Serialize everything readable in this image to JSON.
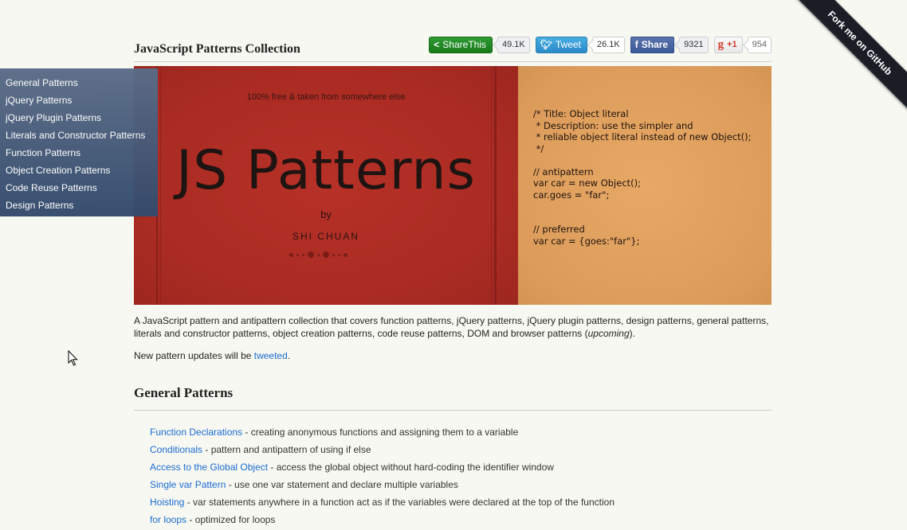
{
  "header": {
    "title": "JavaScript Patterns Collection",
    "social": {
      "sharethis": {
        "label": "ShareThis",
        "count": "49.1K",
        "icon": "share-icon"
      },
      "tweet": {
        "label": "Tweet",
        "count": "26.1K",
        "icon": "twitter-bird-icon"
      },
      "facebook": {
        "label": "Share",
        "count": "9321",
        "icon": "facebook-f-icon"
      },
      "gplus": {
        "label": "+1",
        "count": "954",
        "icon": "google-g-icon"
      }
    }
  },
  "ribbon": {
    "label": "Fork me on GitHub"
  },
  "sidebar": {
    "items": [
      {
        "label": "General Patterns"
      },
      {
        "label": "jQuery Patterns"
      },
      {
        "label": "jQuery Plugin Patterns"
      },
      {
        "label": "Literals and Constructor Patterns"
      },
      {
        "label": "Function Patterns"
      },
      {
        "label": "Object Creation Patterns"
      },
      {
        "label": "Code Reuse Patterns"
      },
      {
        "label": "Design Patterns"
      }
    ]
  },
  "banner": {
    "tagline": "100% free & taken from somewhere else",
    "title": "JS Patterns",
    "by": "by",
    "author": "SHI CHUAN",
    "code": "/* Title: Object literal\n * Description: use the simpler and\n * reliable object literal instead of new Object();\n */\n\n// antipattern\nvar car = new Object();\ncar.goes = \"far\";\n\n\n// preferred\nvar car = {goes:\"far\"};",
    "colors": {
      "cover": "#a92b22",
      "panel": "#dc9b5a"
    }
  },
  "intro": {
    "text_before": "A JavaScript pattern and antipattern collection that covers function patterns, jQuery patterns, jQuery plugin patterns, design patterns, general patterns, literals and constructor patterns, object creation patterns, code reuse patterns, DOM and browser patterns (",
    "emphasis": "upcoming",
    "text_after": ")."
  },
  "update": {
    "text_before": "New pattern updates will be ",
    "link": "tweeted",
    "text_after": "."
  },
  "section": {
    "title": "General Patterns",
    "items": [
      {
        "link": "Function Declarations",
        "desc": " - creating anonymous functions and assigning them to a variable"
      },
      {
        "link": "Conditionals",
        "desc": " - pattern and antipattern of using if else"
      },
      {
        "link": "Access to the Global Object",
        "desc": " - access the global object without hard-coding the identifier window"
      },
      {
        "link": "Single var Pattern",
        "desc": " - use one var statement and declare multiple variables"
      },
      {
        "link": "Hoisting",
        "desc": " - var statements anywhere in a function act as if the variables were declared at the top of the function"
      },
      {
        "link": "for loops",
        "desc": " - optimized for loops"
      }
    ]
  },
  "colors": {
    "link": "#1a6bd1",
    "background": "#f8f8f2",
    "sidebar": "#44587a"
  }
}
